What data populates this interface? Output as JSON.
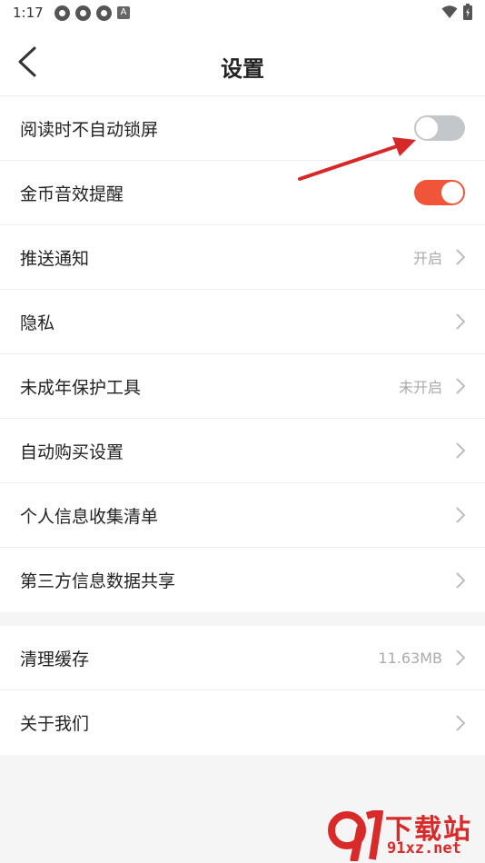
{
  "status_bar": {
    "time": "1:17",
    "notif_letter": "A"
  },
  "header": {
    "title": "设置"
  },
  "settings_group_1": [
    {
      "label": "阅读时不自动锁屏",
      "type": "toggle",
      "enabled": false
    },
    {
      "label": "金币音效提醒",
      "type": "toggle",
      "enabled": true
    },
    {
      "label": "推送通知",
      "type": "link",
      "value": "开启"
    },
    {
      "label": "隐私",
      "type": "link",
      "value": ""
    },
    {
      "label": "未成年保护工具",
      "type": "link",
      "value": "未开启"
    },
    {
      "label": "自动购买设置",
      "type": "link",
      "value": ""
    },
    {
      "label": "个人信息收集清单",
      "type": "link",
      "value": ""
    },
    {
      "label": "第三方信息数据共享",
      "type": "link",
      "value": ""
    }
  ],
  "settings_group_2": [
    {
      "label": "清理缓存",
      "type": "link",
      "value": "11.63MB"
    },
    {
      "label": "关于我们",
      "type": "link",
      "value": ""
    }
  ],
  "watermark": {
    "brand": "下载站",
    "domain": "91xz.net"
  },
  "colors": {
    "accent": "#f0553a",
    "toggle_off": "#c4c7c9",
    "divider": "#eeeeee",
    "annotation_arrow": "#d62828"
  },
  "icons": {
    "back": "chevron-left-icon",
    "row_arrow": "chevron-right-icon"
  }
}
